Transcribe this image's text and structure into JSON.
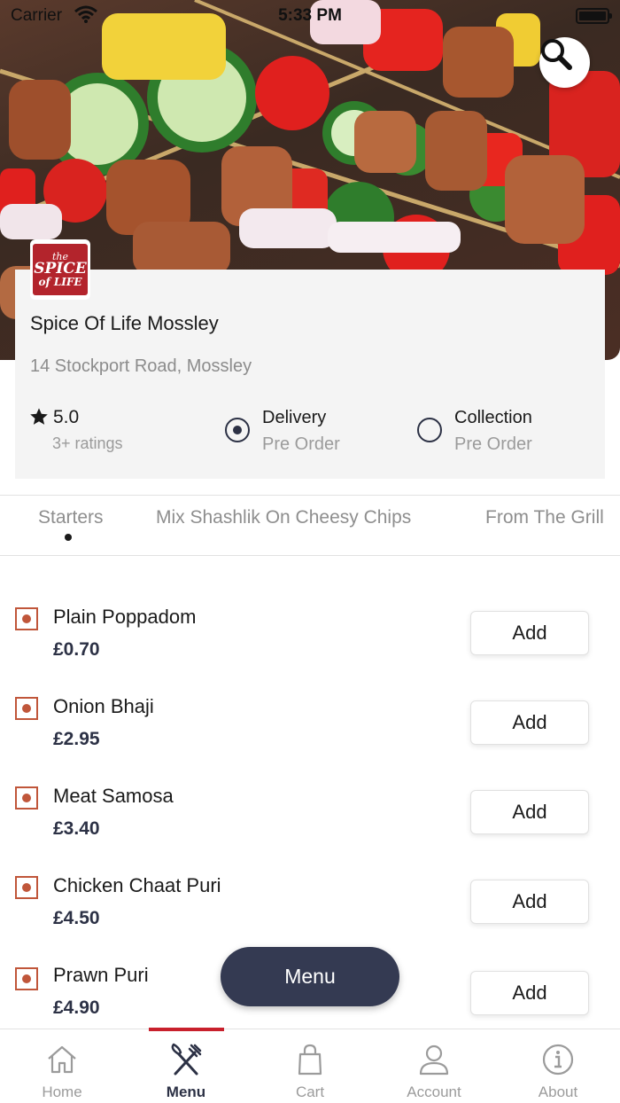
{
  "status_bar": {
    "carrier": "Carrier",
    "time": "5:33 PM"
  },
  "hero": {
    "search_icon": "search-icon"
  },
  "restaurant": {
    "logo_line1": "the",
    "logo_line2": "SPICE",
    "logo_line3": "of LIFE",
    "name": "Spice Of Life Mossley",
    "address": "14 Stockport Road, Mossley",
    "rating": "5.0",
    "rating_count": "3+ ratings"
  },
  "order_options": [
    {
      "title": "Delivery",
      "subtitle": "Pre Order",
      "selected": true
    },
    {
      "title": "Collection",
      "subtitle": "Pre Order",
      "selected": false
    }
  ],
  "categories": [
    {
      "label": "Starters",
      "active": true
    },
    {
      "label": "Mix Shashlik On Cheesy Chips",
      "active": false
    },
    {
      "label": "From The Grill",
      "active": false
    }
  ],
  "menu_items": [
    {
      "name": "Plain Poppadom",
      "price": "£0.70",
      "add_label": "Add"
    },
    {
      "name": "Onion Bhaji",
      "price": "£2.95",
      "add_label": "Add"
    },
    {
      "name": "Meat Samosa",
      "price": "£3.40",
      "add_label": "Add"
    },
    {
      "name": "Chicken Chaat Puri",
      "price": "£4.50",
      "add_label": "Add"
    },
    {
      "name": "Prawn Puri",
      "price": "£4.90",
      "add_label": "Add"
    }
  ],
  "menu_button": {
    "label": "Menu"
  },
  "bottom_nav": [
    {
      "label": "Home",
      "icon": "home-icon",
      "active": false
    },
    {
      "label": "Menu",
      "icon": "fork-knife-icon",
      "active": true
    },
    {
      "label": "Cart",
      "icon": "shopping-bag-icon",
      "active": false
    },
    {
      "label": "Account",
      "icon": "user-icon",
      "active": false
    },
    {
      "label": "About",
      "icon": "info-icon",
      "active": false
    }
  ],
  "colors": {
    "accent": "#c8202c",
    "navy": "#343a52",
    "veg_marker": "#c0563a",
    "card_bg": "#f4f4f4"
  }
}
